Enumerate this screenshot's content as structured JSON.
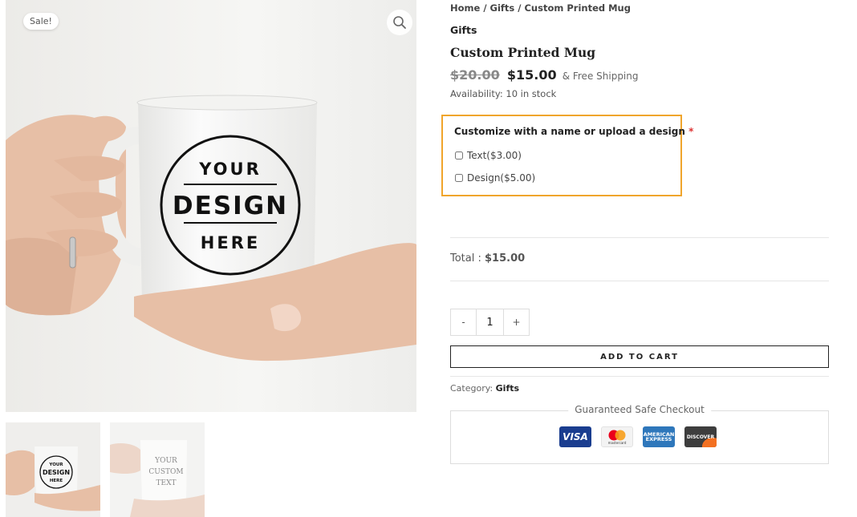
{
  "gallery": {
    "sale_badge": "Sale!",
    "zoom_icon": "magnifier-icon",
    "mug_text": {
      "line1": "YOUR",
      "line2": "DESIGN",
      "line3": "HERE"
    },
    "thumb2_text": {
      "line1": "YOUR",
      "line2": "CUSTOM",
      "line3": "TEXT"
    }
  },
  "breadcrumb": {
    "home": "Home",
    "sep": " / ",
    "gifts": "Gifts",
    "current": "Custom Printed Mug"
  },
  "category_title": "Gifts",
  "product": {
    "title": "Custom Printed Mug",
    "price_old": "$20.00",
    "price_new": "$15.00",
    "shipping": "& Free Shipping",
    "availability": "Availability: 10 in stock"
  },
  "customize": {
    "title": "Customize with a name or upload a design",
    "required_mark": "*",
    "options": [
      {
        "label": "Text($3.00)",
        "checked": false
      },
      {
        "label": "Design($5.00)",
        "checked": false
      }
    ]
  },
  "total": {
    "label": "Total :",
    "value": "$15.00"
  },
  "quantity": {
    "minus": "-",
    "value": "1",
    "plus": "+"
  },
  "add_to_cart": "ADD TO CART",
  "category": {
    "label": "Category:",
    "value": "Gifts"
  },
  "safe_checkout": {
    "title": "Guaranteed Safe Checkout",
    "cards": {
      "visa": "VISA",
      "mastercard": "mastercard",
      "amex": "AMERICAN EXPRESS",
      "discover": "DISCOVER"
    }
  },
  "colors": {
    "accent_border": "#f0a52c",
    "required": "#dd3333"
  }
}
